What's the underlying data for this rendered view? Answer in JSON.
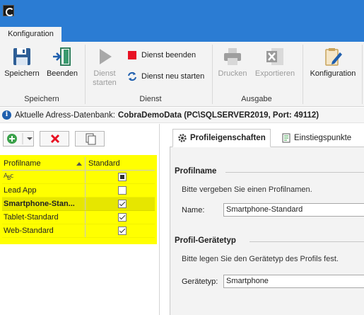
{
  "ribbon": {
    "tab_label": "Konfiguration",
    "groups": {
      "speichern": "Speichern",
      "dienst": "Dienst",
      "ausgabe": "Ausgabe"
    },
    "buttons": {
      "speichern": "Speichern",
      "beenden": "Beenden",
      "dienst_starten_1": "Dienst",
      "dienst_starten_2": "starten",
      "dienst_beenden": "Dienst beenden",
      "dienst_neu_starten": "Dienst neu starten",
      "drucken": "Drucken",
      "exportieren": "Exportieren",
      "konfiguration": "Konfiguration"
    }
  },
  "infobar": {
    "prefix": "Aktuelle Adress-Datenbank:",
    "database": "CobraDemoData (PC\\SQLSERVER2019, Port: 49112)"
  },
  "grid": {
    "columns": [
      "Profilname",
      "Standard"
    ],
    "rows": [
      {
        "name": "",
        "state": "indeterminate"
      },
      {
        "name": "Lead App",
        "state": "unchecked"
      },
      {
        "name": "Smartphone-Stan...",
        "state": "checked"
      },
      {
        "name": "Tablet-Standard",
        "state": "checked"
      },
      {
        "name": "Web-Standard",
        "state": "checked"
      }
    ]
  },
  "tabs": {
    "profile": "Profileigenschaften",
    "entry": "Einstiegspunkte"
  },
  "profile": {
    "section1_title": "Profilname",
    "section1_hint": "Bitte vergeben Sie einen Profilnamen.",
    "name_label": "Name:",
    "name_value": "Smartphone-Standard",
    "section2_title": "Profil-Gerätetyp",
    "section2_hint": "Bitte legen Sie den Gerätetyp des Profils fest.",
    "device_label": "Gerätetyp:",
    "device_value": "Smartphone"
  },
  "colors": {
    "titlebar": "#2b7cd3",
    "highlight": "#ffff00",
    "stop_red": "#e81123"
  }
}
